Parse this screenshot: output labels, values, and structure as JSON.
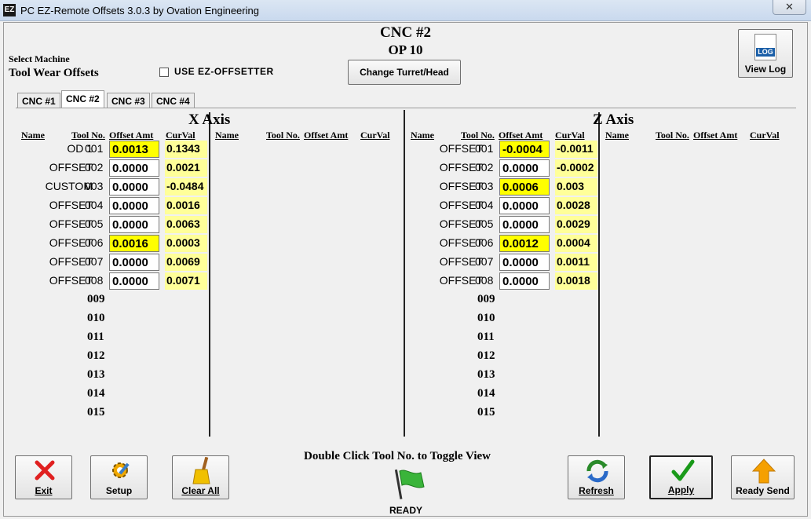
{
  "window": {
    "title": "PC EZ-Remote Offsets 3.0.3 by Ovation Engineering",
    "icon_text": "EZ",
    "close": "✕"
  },
  "header": {
    "machine": "CNC #2",
    "op": "OP 10",
    "select_machine": "Select Machine",
    "section": "Tool Wear Offsets"
  },
  "ez_offsetter": {
    "label": "USE EZ-OFFSETTER",
    "checked": false
  },
  "change_turret_button": "Change Turret/Head",
  "view_log_button": {
    "label": "View Log",
    "icon_text": "LOG"
  },
  "tabs": [
    "CNC #1",
    "CNC #2",
    "CNC #3",
    "CNC #4"
  ],
  "active_tab": "CNC #2",
  "columns": {
    "name": "Name",
    "tool_no": "Tool No.",
    "offset_amt": "Offset Amt",
    "curval": "CurVal"
  },
  "x_axis": {
    "title": "X Axis",
    "rows": [
      {
        "name": "OD 1",
        "tool": "001",
        "offset": "0.0013",
        "cur": "0.1343",
        "hl": true
      },
      {
        "name": "OFFSET",
        "tool": "002",
        "offset": "0.0000",
        "cur": "0.0021",
        "hl": false
      },
      {
        "name": "CUSTOM",
        "tool": "003",
        "offset": "0.0000",
        "cur": "-0.0484",
        "hl": false
      },
      {
        "name": "OFFSET",
        "tool": "004",
        "offset": "0.0000",
        "cur": "0.0016",
        "hl": false
      },
      {
        "name": "OFFSET",
        "tool": "005",
        "offset": "0.0000",
        "cur": "0.0063",
        "hl": false
      },
      {
        "name": "OFFSET",
        "tool": "006",
        "offset": "0.0016",
        "cur": "0.0003",
        "hl": true
      },
      {
        "name": "OFFSET",
        "tool": "007",
        "offset": "0.0000",
        "cur": "0.0069",
        "hl": false
      },
      {
        "name": "OFFSET",
        "tool": "008",
        "offset": "0.0000",
        "cur": "0.0071",
        "hl": false
      },
      {
        "tool": "009"
      },
      {
        "tool": "010"
      },
      {
        "tool": "011"
      },
      {
        "tool": "012"
      },
      {
        "tool": "013"
      },
      {
        "tool": "014"
      },
      {
        "tool": "015"
      }
    ]
  },
  "z_axis": {
    "title": "Z Axis",
    "rows": [
      {
        "name": "OFFSET",
        "tool": "001",
        "offset": "-0.0004",
        "cur": "-0.0011",
        "hl": true
      },
      {
        "name": "OFFSET",
        "tool": "002",
        "offset": "0.0000",
        "cur": "-0.0002",
        "hl": false
      },
      {
        "name": "OFFSET",
        "tool": "003",
        "offset": "0.0006",
        "cur": "0.003",
        "hl": true
      },
      {
        "name": "OFFSET",
        "tool": "004",
        "offset": "0.0000",
        "cur": "0.0028",
        "hl": false
      },
      {
        "name": "OFFSET",
        "tool": "005",
        "offset": "0.0000",
        "cur": "0.0029",
        "hl": false
      },
      {
        "name": "OFFSET",
        "tool": "006",
        "offset": "0.0012",
        "cur": "0.0004",
        "hl": true
      },
      {
        "name": "OFFSET",
        "tool": "007",
        "offset": "0.0000",
        "cur": "0.0011",
        "hl": false
      },
      {
        "name": "OFFSET",
        "tool": "008",
        "offset": "0.0000",
        "cur": "0.0018",
        "hl": false
      },
      {
        "tool": "009"
      },
      {
        "tool": "010"
      },
      {
        "tool": "011"
      },
      {
        "tool": "012"
      },
      {
        "tool": "013"
      },
      {
        "tool": "014"
      },
      {
        "tool": "015"
      }
    ]
  },
  "hint": "Double Click Tool No. to Toggle View",
  "status": "READY",
  "buttons": {
    "exit": "Exit",
    "setup": "Setup",
    "clear_all": "Clear All",
    "refresh": "Refresh",
    "apply": "Apply",
    "ready_send": "Ready Send"
  },
  "colors": {
    "highlight": "#ffff00",
    "curval_bg": "#ffff99",
    "exit_red": "#e02020",
    "apply_green": "#1a9a1a",
    "arrow_orange": "#f5a000"
  }
}
